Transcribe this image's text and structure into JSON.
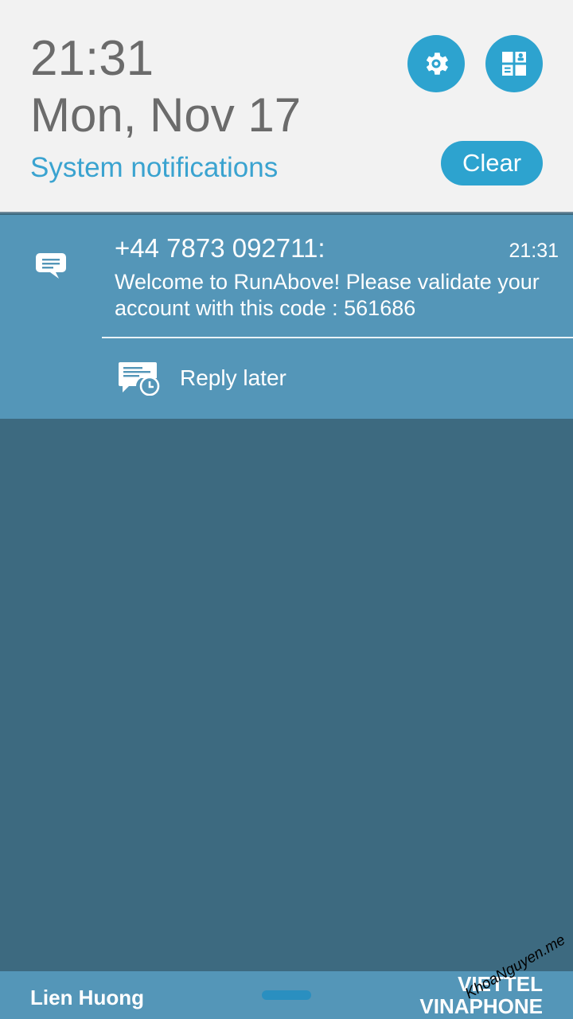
{
  "header": {
    "time": "21:31",
    "date": "Mon, Nov 17",
    "section_title": "System notifications",
    "clear_label": "Clear",
    "settings_icon": "gear-icon",
    "quick_settings_icon": "grid-icon",
    "accent_color": "#2da3cf"
  },
  "notification": {
    "app_icon": "message-icon",
    "sender": "+44 7873 092711:",
    "time": "21:31",
    "message": "Welcome to RunAbove! Please validate your account with this code : 561686",
    "action": {
      "label": "Reply later",
      "icon": "reply-later-icon"
    },
    "background_color": "#5496b8"
  },
  "status_bar": {
    "carrier_left": "Lien Huong",
    "carrier_right_line1": "VIETTEL",
    "carrier_right_line2": "VINAPHONE",
    "watermark": "KhoaNguyen.me"
  }
}
